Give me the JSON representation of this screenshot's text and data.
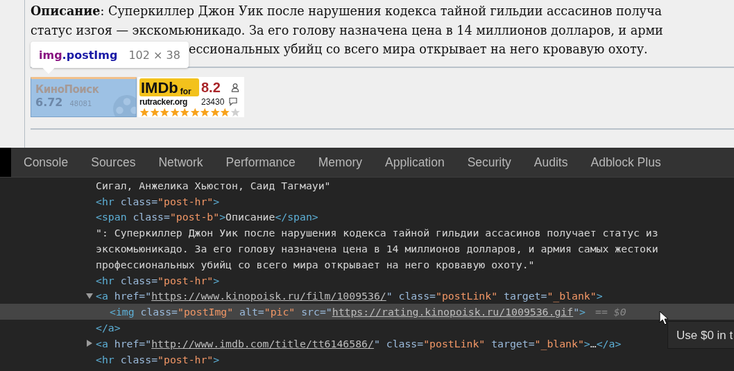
{
  "post": {
    "description_lines": [
      "**Описание**: Суперкиллер Джон Уик после нарушения кодекса тайной гильдии ассасинов получа",
      "статус изгоя — экскомьюникадо. За его голову назначена цена в 14 миллионов долларов, и арми"
    ],
    "description_tail": "ессиональных убийц со всего мира открывает на него кровавую охоту.",
    "inspect_tooltip": {
      "selector": "img.postImg",
      "size": "102 × 38"
    },
    "kinopoisk": {
      "logo": "КиноПоиск",
      "rating": "6.72",
      "votes": "48081"
    },
    "imdb": {
      "logo": "IMDb",
      "for": "for",
      "site": "rutracker.org",
      "rating": "8.2",
      "votes": "23430",
      "stars": 9
    }
  },
  "devtools": {
    "tabs": [
      {
        "label": "Console",
        "selected": false
      },
      {
        "label": "Sources",
        "selected": false
      },
      {
        "label": "Network",
        "selected": false
      },
      {
        "label": "Performance",
        "selected": false
      },
      {
        "label": "Memory",
        "selected": false
      },
      {
        "label": "Application",
        "selected": false
      },
      {
        "label": "Security",
        "selected": false
      },
      {
        "label": "Audits",
        "selected": false
      },
      {
        "label": "Adblock Plus",
        "selected": false
      }
    ],
    "nodes": [
      {
        "tokens": [
          {
            "kind": "text",
            "text": "Сигал, Анжелика Хьюстон, Саид Тагмауи\""
          }
        ]
      },
      {
        "tokens": [
          {
            "kind": "tag",
            "text": "<hr"
          },
          {
            "kind": "attr",
            "text": " class="
          },
          {
            "kind": "value",
            "text": "\"post-hr\""
          },
          {
            "kind": "tag",
            "text": ">"
          }
        ]
      },
      {
        "tokens": [
          {
            "kind": "tag",
            "text": "<span"
          },
          {
            "kind": "attr",
            "text": " class="
          },
          {
            "kind": "value",
            "text": "\"post-b\""
          },
          {
            "kind": "tag",
            "text": ">"
          },
          {
            "kind": "text",
            "text": "Описание"
          },
          {
            "kind": "tag",
            "text": "</span>"
          }
        ]
      },
      {
        "tokens": [
          {
            "kind": "text",
            "text": "\": Суперкиллер Джон Уик после нарушения кодекса тайной гильдии ассасинов получает статус из"
          }
        ]
      },
      {
        "tokens": [
          {
            "kind": "text",
            "text": "экскомьюникадо. За его голову назначена цена в 14 миллионов долларов, и армия самых жестоки"
          }
        ]
      },
      {
        "tokens": [
          {
            "kind": "text",
            "text": "профессиональных убийц со всего мира открывает на него кровавую охоту.\""
          }
        ]
      },
      {
        "tokens": [
          {
            "kind": "tag",
            "text": "<hr"
          },
          {
            "kind": "attr",
            "text": " class="
          },
          {
            "kind": "value",
            "text": "\"post-hr\""
          },
          {
            "kind": "tag",
            "text": ">"
          }
        ]
      },
      {
        "expanded": true,
        "tokens": [
          {
            "kind": "tag",
            "text": "<a"
          },
          {
            "kind": "attr",
            "text": " href=\""
          },
          {
            "kind": "link",
            "text": "https://www.kinopoisk.ru/film/1009536/"
          },
          {
            "kind": "attr",
            "text": "\" class="
          },
          {
            "kind": "value",
            "text": "\"postLink\""
          },
          {
            "kind": "attr",
            "text": " target="
          },
          {
            "kind": "value",
            "text": "\"_blank\""
          },
          {
            "kind": "tag",
            "text": ">"
          }
        ],
        "children": [
          {
            "selected": true,
            "suffix": "== $0",
            "tokens": [
              {
                "kind": "tag",
                "text": "<img"
              },
              {
                "kind": "attr",
                "text": " class="
              },
              {
                "kind": "value",
                "text": "\"postImg\""
              },
              {
                "kind": "attr",
                "text": " alt="
              },
              {
                "kind": "value",
                "text": "\"pic\""
              },
              {
                "kind": "attr",
                "text": " src=\""
              },
              {
                "kind": "link",
                "text": "https://rating.kinopoisk.ru/1009536.gif"
              },
              {
                "kind": "attr",
                "text": "\""
              },
              {
                "kind": "tag",
                "text": ">"
              }
            ]
          }
        ],
        "closing": [
          {
            "kind": "tag",
            "text": "</a>"
          }
        ]
      },
      {
        "expanded": false,
        "tokens": [
          {
            "kind": "tag",
            "text": "<a"
          },
          {
            "kind": "attr",
            "text": " href=\""
          },
          {
            "kind": "link",
            "text": "http://www.imdb.com/title/tt6146586/"
          },
          {
            "kind": "attr",
            "text": "\" class="
          },
          {
            "kind": "value",
            "text": "\"postLink\""
          },
          {
            "kind": "attr",
            "text": " target="
          },
          {
            "kind": "value",
            "text": "\"_blank\""
          },
          {
            "kind": "tag",
            "text": ">"
          },
          {
            "kind": "text",
            "text": "…"
          },
          {
            "kind": "tag",
            "text": "</a>"
          }
        ]
      },
      {
        "tokens": [
          {
            "kind": "tag",
            "text": "<hr"
          },
          {
            "kind": "attr",
            "text": " class="
          },
          {
            "kind": "value",
            "text": "\"post-hr\""
          },
          {
            "kind": "tag",
            "text": ">"
          }
        ]
      }
    ],
    "hint_tooltip": "Use $0 in t"
  }
}
